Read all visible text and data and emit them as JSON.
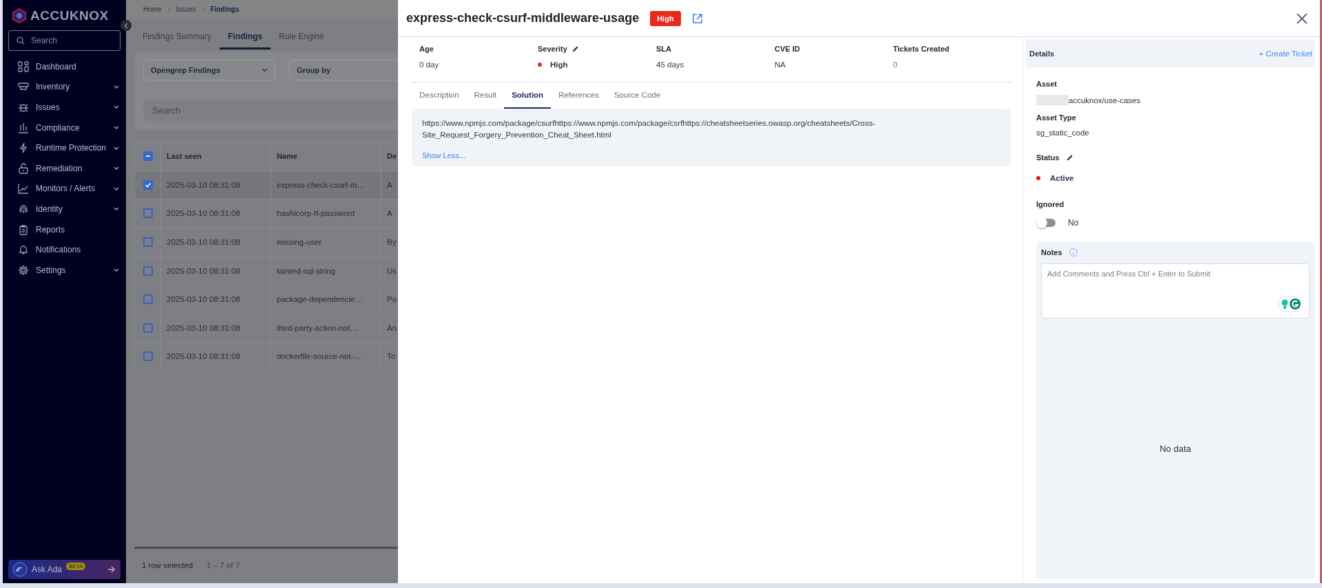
{
  "sidebar": {
    "logo": "ACCUKNOX",
    "search": {
      "placeholder": "Search"
    },
    "items": [
      {
        "label": "Dashboard",
        "expandable": false
      },
      {
        "label": "Inventory",
        "expandable": true
      },
      {
        "label": "Issues",
        "expandable": true
      },
      {
        "label": "Compliance",
        "expandable": true
      },
      {
        "label": "Runtime Protection",
        "expandable": true
      },
      {
        "label": "Remediation",
        "expandable": true
      },
      {
        "label": "Monitors / Alerts",
        "expandable": true
      },
      {
        "label": "Identity",
        "expandable": true
      },
      {
        "label": "Reports",
        "expandable": false
      },
      {
        "label": "Notifications",
        "expandable": false
      },
      {
        "label": "Settings",
        "expandable": true
      }
    ],
    "assistant": {
      "label": "Ask Ada",
      "badge": "BETA"
    }
  },
  "breadcrumb": [
    "Home",
    "Issues",
    "Findings"
  ],
  "tabs": [
    {
      "label": "Findings Summary",
      "selected": false
    },
    {
      "label": "Findings",
      "selected": true
    },
    {
      "label": "Rule Engine",
      "selected": false
    }
  ],
  "filters": {
    "source": "Opengrep Findings",
    "group_by": "Group by",
    "search": {
      "placeholder": "Search"
    }
  },
  "table": {
    "select_all": {
      "partial": true
    },
    "columns": [
      "Last seen",
      "Name",
      "De"
    ],
    "rows": [
      {
        "selected": true,
        "cells": [
          "2025-03-10 08:31:08",
          "express-check-csurf-m…",
          "A"
        ]
      },
      {
        "selected": false,
        "cells": [
          "2025-03-10 08:31:08",
          "hashicorp-tf-password",
          "A"
        ]
      },
      {
        "selected": false,
        "cells": [
          "2025-03-10 08:31:08",
          "missing-user",
          "By"
        ]
      },
      {
        "selected": false,
        "cells": [
          "2025-03-10 08:31:08",
          "tainted-sql-string",
          "Us"
        ]
      },
      {
        "selected": false,
        "cells": [
          "2025-03-10 08:31:08",
          "package-dependencie…",
          "Po"
        ]
      },
      {
        "selected": false,
        "cells": [
          "2025-03-10 08:31:08",
          "third-party-action-not…",
          "An"
        ]
      },
      {
        "selected": false,
        "cells": [
          "2025-03-10 08:31:08",
          "dockerfile-source-not-…",
          "To"
        ]
      }
    ],
    "footer": {
      "selection": "1 row selected",
      "range": "1 – 7 of 7"
    }
  },
  "drawer": {
    "title": "express-check-csurf-middleware-usage",
    "badge": "High",
    "stats": [
      {
        "kind": "text",
        "label": "Age",
        "value": "0 day",
        "editable": false
      },
      {
        "kind": "severity",
        "label": "Severity",
        "value": "High",
        "color": "#e8291c",
        "editable": true
      },
      {
        "kind": "text",
        "label": "SLA",
        "value": "45 days",
        "editable": false
      },
      {
        "kind": "text",
        "label": "CVE ID",
        "value": "NA",
        "editable": false
      },
      {
        "kind": "link",
        "label": "Tickets Created",
        "value": "0",
        "editable": false
      }
    ],
    "tabs": [
      {
        "label": "Description",
        "selected": false
      },
      {
        "label": "Result",
        "selected": false
      },
      {
        "label": "Solution",
        "selected": true
      },
      {
        "label": "References",
        "selected": false
      },
      {
        "label": "Source Code",
        "selected": false
      }
    ],
    "solution": {
      "text": "https://www.npmjs.com/package/csurfhttps://www.npmjs.com/package/csrfhttps://cheatsheetseries.owasp.org/cheatsheets/Cross-Site_Request_Forgery_Prevention_Cheat_Sheet.html",
      "toggle": "Show Less..."
    },
    "details": {
      "title": "Details",
      "action": "+ Create Ticket",
      "asset": {
        "label": "Asset",
        "value": "accuknox/use-cases",
        "redacted": true
      },
      "asset_type": {
        "label": "Asset Type",
        "value": "sg_static_code"
      },
      "status": {
        "label": "Status",
        "value": "Active",
        "color": "#ee1111"
      },
      "ignored": {
        "label": "Ignored",
        "on": false,
        "value": "No"
      },
      "notes": {
        "label": "Notes",
        "placeholder": "Add Comments and Press Ctrl + Enter to Submit",
        "empty": "No data"
      }
    }
  }
}
